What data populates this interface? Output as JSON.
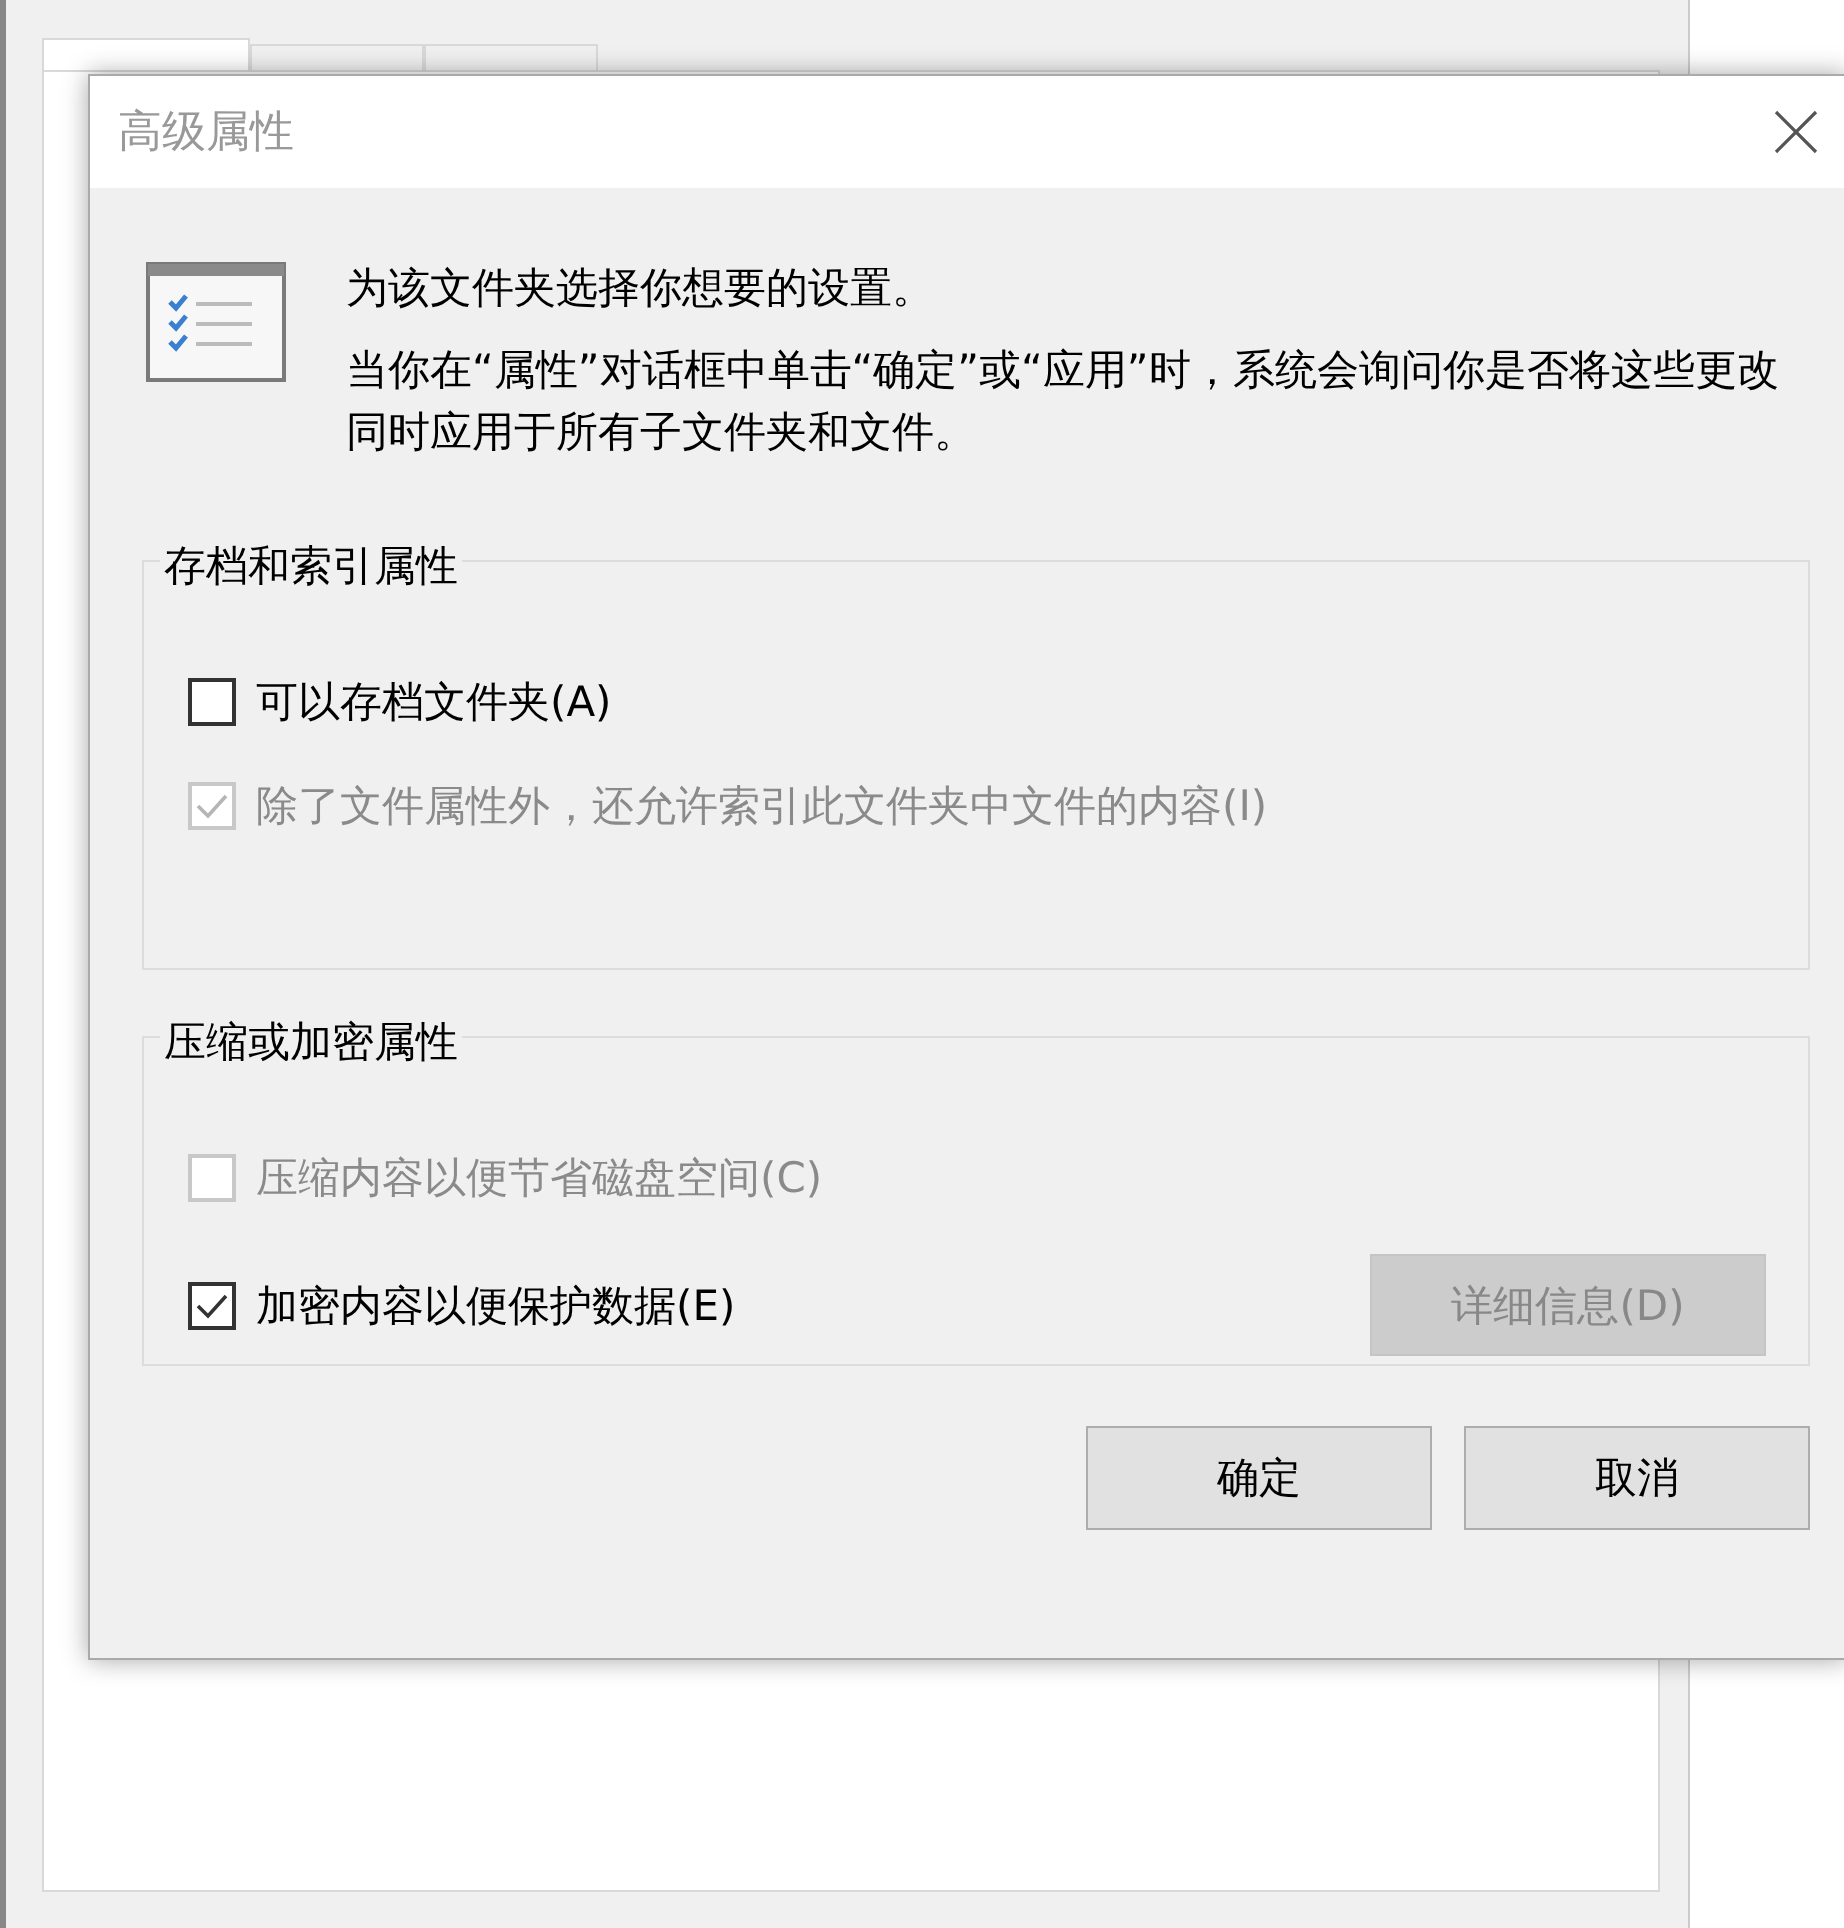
{
  "background_window": {
    "tabs": [
      {
        "selected": true
      },
      {
        "selected": false
      },
      {
        "selected": false
      }
    ]
  },
  "dialog": {
    "title": "高级属性",
    "intro": {
      "heading": "为该文件夹选择你想要的设置。",
      "text": "当你在“属性”对话框中单击“确定”或“应用”时，系统会询问你是否将这些更改同时应用于所有子文件夹和文件。"
    },
    "groups": [
      {
        "title": "存档和索引属性",
        "options": [
          {
            "label": "可以存档文件夹(A)",
            "checked": false,
            "disabled": false
          },
          {
            "label": "除了文件属性外，还允许索引此文件夹中文件的内容(I)",
            "checked": true,
            "disabled": true
          }
        ]
      },
      {
        "title": "压缩或加密属性",
        "options": [
          {
            "label": "压缩内容以便节省磁盘空间(C)",
            "checked": false,
            "disabled": true
          },
          {
            "label": "加密内容以便保护数据(E)",
            "checked": true,
            "disabled": false
          }
        ],
        "button": {
          "label": "详细信息(D)",
          "disabled": true
        }
      }
    ],
    "buttons": [
      "确定",
      "取消"
    ]
  }
}
